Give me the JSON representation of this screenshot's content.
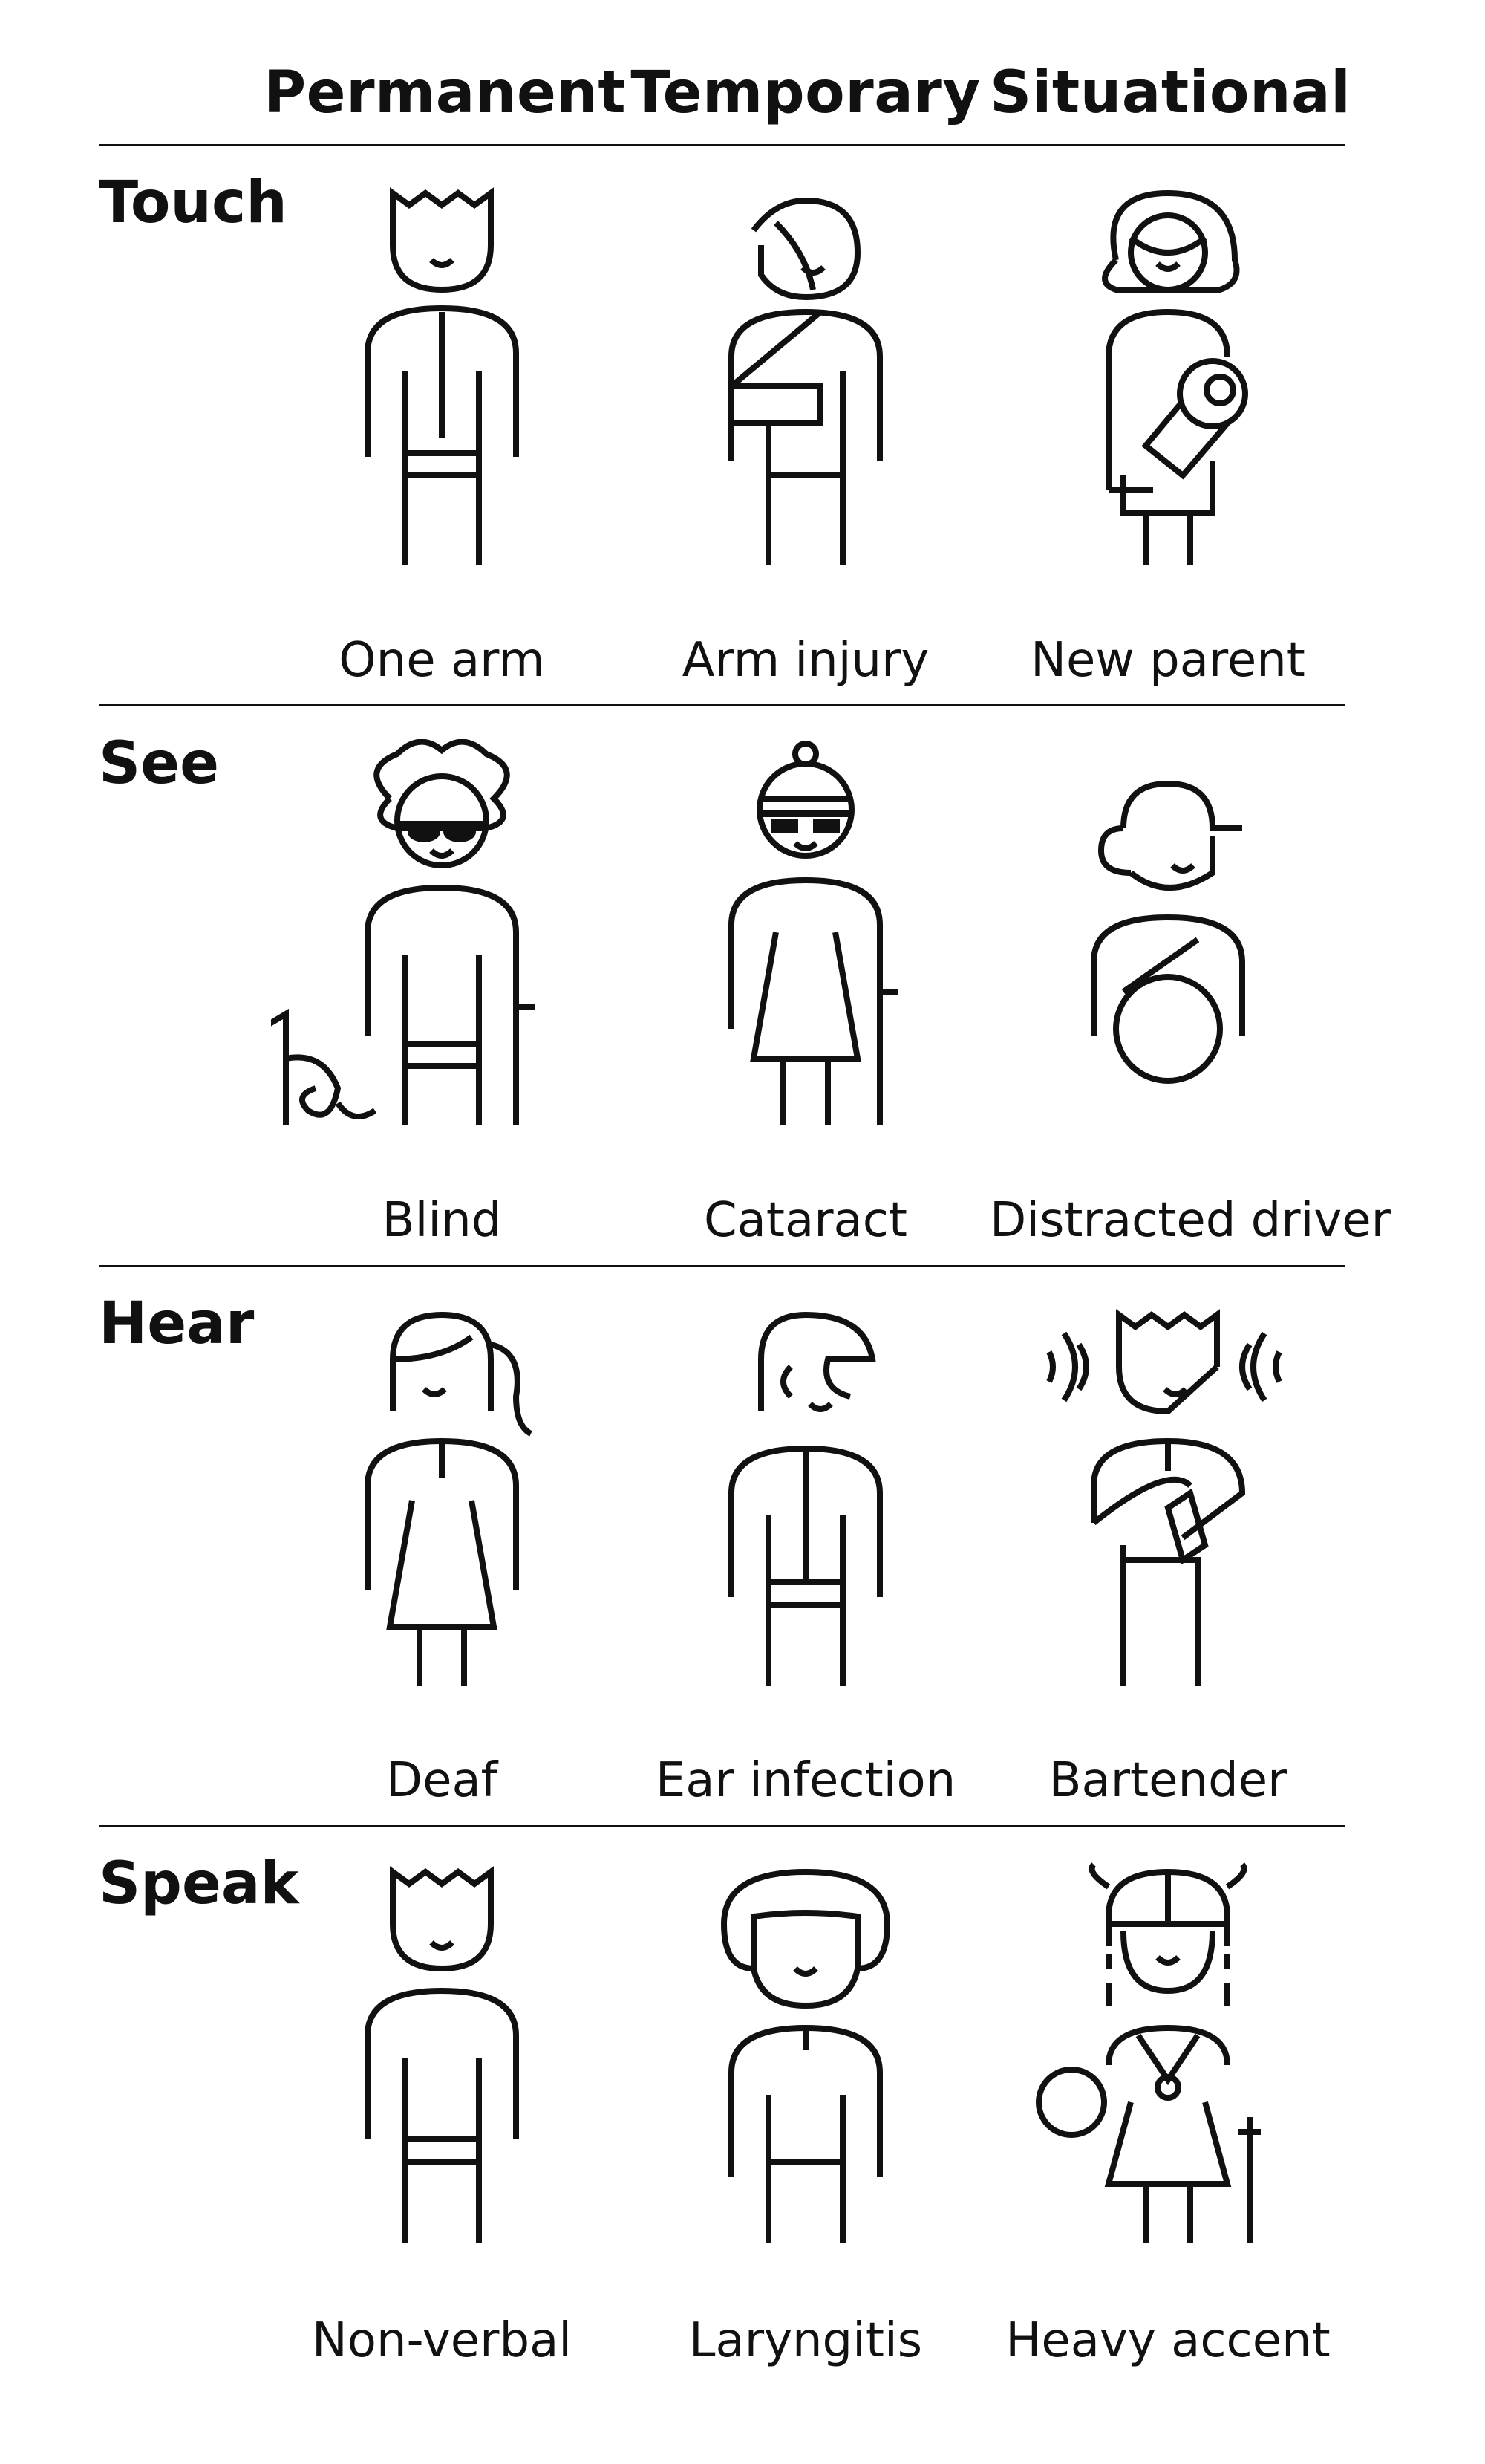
{
  "columns": [
    "Permanent",
    "Temporary",
    "Situational"
  ],
  "rows": [
    {
      "title": "Touch",
      "items": [
        {
          "label": "One arm",
          "icon": "person-one-arm-icon"
        },
        {
          "label": "Arm injury",
          "icon": "person-arm-sling-icon"
        },
        {
          "label": "New parent",
          "icon": "person-holding-baby-icon"
        }
      ]
    },
    {
      "title": "See",
      "items": [
        {
          "label": "Blind",
          "icon": "person-with-guide-dog-icon"
        },
        {
          "label": "Cataract",
          "icon": "person-with-cane-icon"
        },
        {
          "label": "Distracted driver",
          "icon": "person-driving-icon"
        }
      ]
    },
    {
      "title": "Hear",
      "items": [
        {
          "label": "Deaf",
          "icon": "person-ponytail-icon"
        },
        {
          "label": "Ear infection",
          "icon": "person-ear-icon"
        },
        {
          "label": "Bartender",
          "icon": "person-with-noise-icon"
        }
      ]
    },
    {
      "title": "Speak",
      "items": [
        {
          "label": "Non-verbal",
          "icon": "person-spiky-hair-icon"
        },
        {
          "label": "Laryngitis",
          "icon": "person-bob-hair-icon"
        },
        {
          "label": "Heavy accent",
          "icon": "person-with-helmet-icon"
        }
      ]
    }
  ],
  "colors": {
    "ink": "#111111",
    "background": "#ffffff"
  }
}
